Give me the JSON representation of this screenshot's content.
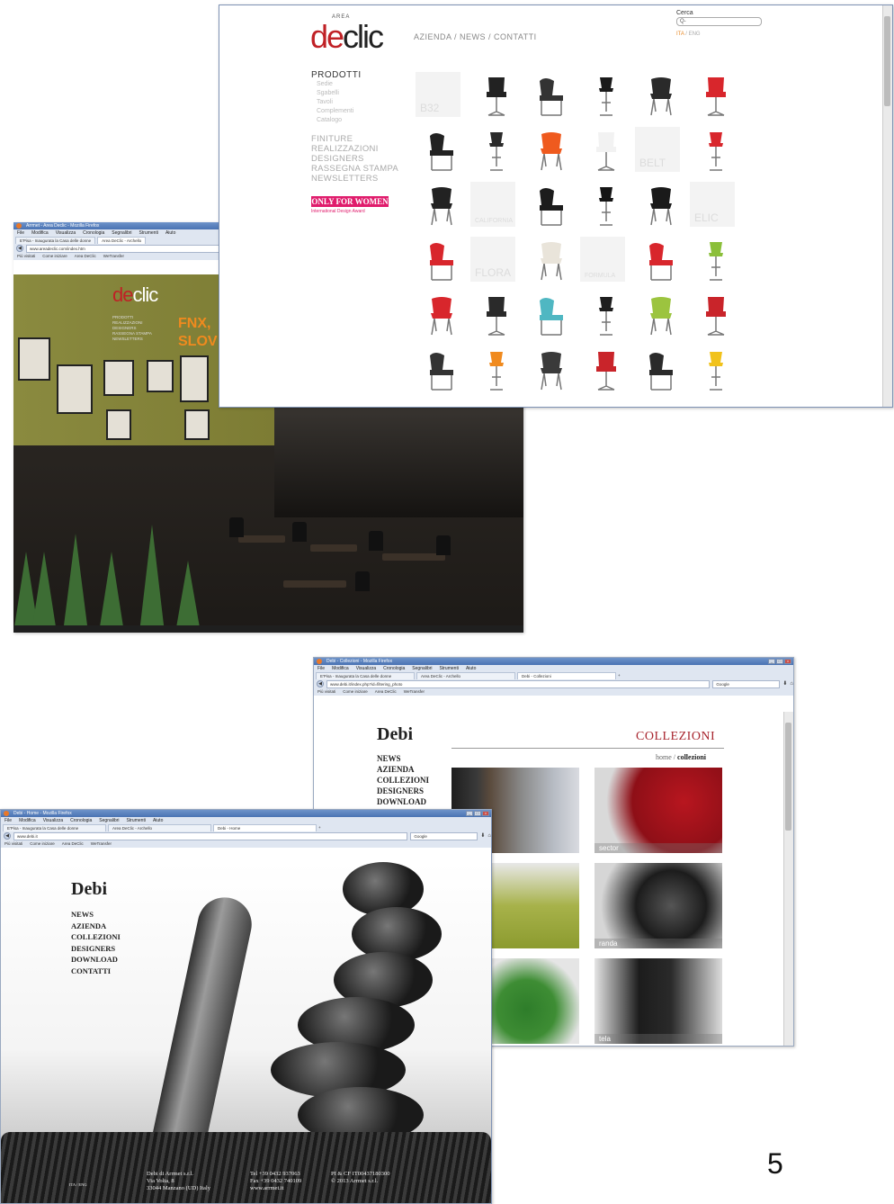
{
  "slide_number": "5",
  "win_declic_home": {
    "title": "Arrmet - Area Declic - Mozilla Firefox",
    "menu": [
      "File",
      "Modifica",
      "Visualizza",
      "Cronologia",
      "Segnalibri",
      "Strumenti",
      "Aiuto"
    ],
    "tabs": [
      "E'Pisa - Inaugurata la Casa delle donne",
      "Area DeClic - Archello"
    ],
    "url": "www.areadeclic.com/index.htm",
    "bookmarks": [
      "Più visitati",
      "Come iniziare",
      "Area DeClic",
      "WeTransfer"
    ],
    "logo_de": "de",
    "logo_clic": "clic",
    "side_menu": [
      "PRODOTTI",
      "REALIZZAZIONI",
      "DESIGNERS",
      "RASSEGNA STAMPA",
      "NEWSLETTERS"
    ],
    "headline": [
      "FNX,",
      "SLOV"
    ]
  },
  "win_declic_products": {
    "logo_area": "AREA",
    "logo_de": "de",
    "logo_clic": "clic",
    "nav": "AZIENDA / NEWS / CONTATTI",
    "search_label": "Cerca",
    "search_placeholder": "Q-",
    "lang_ita": "ITA",
    "lang_sep": " / ",
    "lang_eng": "ENG",
    "menu_head": "PRODOTTI",
    "menu_sub": [
      "Sedie",
      "Sgabelli",
      "Tavoli",
      "Complementi",
      "Catalogo"
    ],
    "menu_main": [
      "FINITURE",
      "REALIZZAZIONI",
      "DESIGNERS",
      "RASSEGNA STAMPA",
      "NEWSLETTERS"
    ],
    "women_label": "ONLY FOR WOMEN",
    "women_sub": "International Design Award",
    "grid": [
      {
        "kind": "ph",
        "label": "B32"
      },
      {
        "kind": "chair",
        "color": "#222"
      },
      {
        "kind": "chair",
        "color": "#333"
      },
      {
        "kind": "chair",
        "color": "#1a1a1a"
      },
      {
        "kind": "chair",
        "color": "#2a2a2a"
      },
      {
        "kind": "chair",
        "color": "#d8262c"
      },
      {
        "kind": "chair",
        "color": "#222"
      },
      {
        "kind": "chair",
        "color": "#2b2b2b"
      },
      {
        "kind": "chair",
        "color": "#ef5a1e"
      },
      {
        "kind": "chair",
        "color": "#f2f2f2"
      },
      {
        "kind": "ph",
        "label": "BELT"
      },
      {
        "kind": "chair",
        "color": "#d8262c"
      },
      {
        "kind": "chair",
        "color": "#222"
      },
      {
        "kind": "ph",
        "label": "CALIFORNIA"
      },
      {
        "kind": "chair",
        "color": "#1c1c1c"
      },
      {
        "kind": "chair",
        "color": "#151515"
      },
      {
        "kind": "chair",
        "color": "#1a1a1a"
      },
      {
        "kind": "ph",
        "label": "ELIC"
      },
      {
        "kind": "chair",
        "color": "#d8262c"
      },
      {
        "kind": "ph",
        "label": "FLORA"
      },
      {
        "kind": "chair",
        "color": "#e9e4da"
      },
      {
        "kind": "ph",
        "label": "FORMULA"
      },
      {
        "kind": "chair",
        "color": "#d8262c"
      },
      {
        "kind": "chair",
        "color": "#8bbf3a"
      },
      {
        "kind": "chair",
        "color": "#d8262c"
      },
      {
        "kind": "chair",
        "color": "#2a2a2a"
      },
      {
        "kind": "chair",
        "color": "#4fb7c2"
      },
      {
        "kind": "chair",
        "color": "#1e1e1e"
      },
      {
        "kind": "chair",
        "color": "#9cc43f"
      },
      {
        "kind": "chair",
        "color": "#c9242a"
      },
      {
        "kind": "chair",
        "color": "#333"
      },
      {
        "kind": "chair",
        "color": "#f08a1e"
      },
      {
        "kind": "chair",
        "color": "#3a3a3a"
      },
      {
        "kind": "chair",
        "color": "#c9242a"
      },
      {
        "kind": "chair",
        "color": "#2a2a2a"
      },
      {
        "kind": "chair",
        "color": "#f1c21b"
      }
    ]
  },
  "win_debi_coll": {
    "title": "Debi - Collezioni - Mozilla Firefox",
    "menu": [
      "File",
      "Modifica",
      "Visualizza",
      "Cronologia",
      "Segnalibri",
      "Strumenti",
      "Aiuto"
    ],
    "tabs": [
      "E'Pisa - Inaugurata la Casa delle donne",
      "Area DeClic - Archello",
      "Debi - Collezioni"
    ],
    "url": "www.debi.it/index.php?id=filtering_photo",
    "search": "Google",
    "bookmarks": [
      "Più visitati",
      "Come iniziare",
      "Area DeClic",
      "WeTransfer"
    ],
    "logo": "Debi",
    "menu_items": [
      "NEWS",
      "AZIENDA",
      "COLLEZIONI",
      "DESIGNERS",
      "DOWNLOAD"
    ],
    "section_title": "COLLEZIONI",
    "crumb_home": "home",
    "crumb_sep": " / ",
    "crumb_current": "collezioni",
    "tiles": [
      "sector",
      "randa",
      "tela"
    ]
  },
  "win_debi_home": {
    "title": "Debi - Home - Mozilla Firefox",
    "menu": [
      "File",
      "Modifica",
      "Visualizza",
      "Cronologia",
      "Segnalibri",
      "Strumenti",
      "Aiuto"
    ],
    "tabs": [
      "E'Pisa - Inaugurata la Casa delle donne",
      "Area DeClic - Archello",
      "Debi - Home"
    ],
    "url": "www.debi.it",
    "search": "Google",
    "bookmarks": [
      "Più visitati",
      "Come iniziare",
      "Area DeClic",
      "WeTransfer"
    ],
    "logo": "Debi",
    "menu_items": [
      "NEWS",
      "AZIENDA",
      "COLLEZIONI",
      "DESIGNERS",
      "DOWNLOAD",
      "CONTATTI"
    ],
    "lang": "ITA / ENG",
    "footer_col1": [
      "Debi di Arrmet s.r.l.",
      "Via Volta, 8",
      "33044 Manzano (UD) Italy"
    ],
    "footer_col2": [
      "Tel +39 0432 937063",
      "Fax +39 0432 740109",
      "www.arrmet.it"
    ],
    "footer_col3": [
      "PI & CF IT00437180300",
      "© 2013 Arrmet s.r.l."
    ]
  }
}
